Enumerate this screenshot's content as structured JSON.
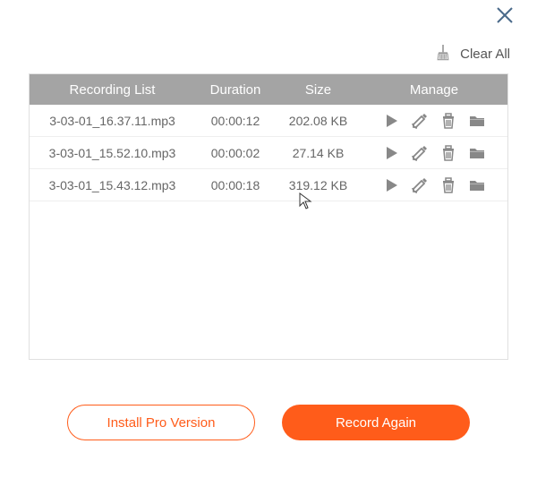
{
  "close_label": "Close",
  "clear_all_label": "Clear All",
  "table": {
    "headers": {
      "name": "Recording List",
      "duration": "Duration",
      "size": "Size",
      "manage": "Manage"
    },
    "rows": [
      {
        "name": "3-03-01_16.37.11.mp3",
        "duration": "00:00:12",
        "size": "202.08 KB"
      },
      {
        "name": "3-03-01_15.52.10.mp3",
        "duration": "00:00:02",
        "size": "27.14 KB"
      },
      {
        "name": "3-03-01_15.43.12.mp3",
        "duration": "00:00:18",
        "size": "319.12 KB"
      }
    ]
  },
  "icons": {
    "play": "play-icon",
    "edit": "edit-icon",
    "delete": "trash-icon",
    "folder": "folder-icon",
    "broom": "broom-icon"
  },
  "buttons": {
    "install_pro": "Install Pro Version",
    "record_again": "Record Again"
  }
}
